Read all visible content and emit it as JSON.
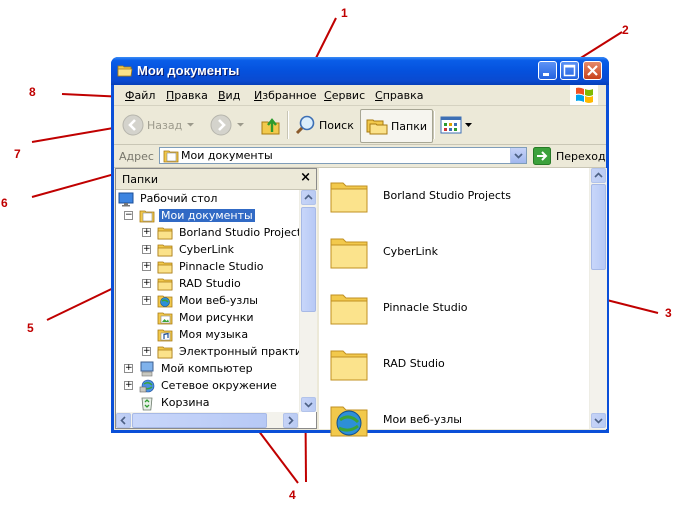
{
  "callouts": [
    "1",
    "2",
    "3",
    "4",
    "5",
    "6",
    "7",
    "8"
  ],
  "window": {
    "title": "Мои документы",
    "buttons": [
      "minimize",
      "maximize",
      "close"
    ]
  },
  "menu": {
    "items": [
      {
        "u": "Ф",
        "rest": "айл"
      },
      {
        "u": "П",
        "rest": "равка"
      },
      {
        "u": "В",
        "rest": "ид"
      },
      {
        "u": "И",
        "rest": "збранное"
      },
      {
        "u": "С",
        "rest": "ервис"
      },
      {
        "u": "С",
        "rest": "правка"
      }
    ]
  },
  "toolbar": {
    "back_label": "Назад",
    "search_label": "Поиск",
    "folders_label": "Папки"
  },
  "address": {
    "label": "Адрес",
    "value": "Мои документы",
    "go_label": "Переход"
  },
  "folder_pane": {
    "title": "Папки",
    "tree": [
      {
        "label": "Рабочий стол",
        "icon": "desktop-icon",
        "level": 0,
        "expander": ""
      },
      {
        "label": "Мои документы",
        "icon": "my-documents-icon",
        "level": 1,
        "expander": "−",
        "selected": true
      },
      {
        "label": "Borland Studio Projects",
        "icon": "folder-icon",
        "level": 2,
        "expander": "+"
      },
      {
        "label": "CyberLink",
        "icon": "folder-icon",
        "level": 2,
        "expander": "+"
      },
      {
        "label": "Pinnacle Studio",
        "icon": "folder-icon",
        "level": 2,
        "expander": "+"
      },
      {
        "label": "RAD Studio",
        "icon": "folder-icon",
        "level": 2,
        "expander": "+"
      },
      {
        "label": "Мои веб-узлы",
        "icon": "web-folder-icon",
        "level": 2,
        "expander": "+"
      },
      {
        "label": "Мои рисунки",
        "icon": "pictures-folder-icon",
        "level": 2,
        "expander": ""
      },
      {
        "label": "Моя музыка",
        "icon": "music-folder-icon",
        "level": 2,
        "expander": ""
      },
      {
        "label": "Электронный практикум",
        "icon": "folder-icon",
        "level": 2,
        "expander": "+"
      },
      {
        "label": "Мой компьютер",
        "icon": "computer-icon",
        "level": 1,
        "expander": "+"
      },
      {
        "label": "Сетевое окружение",
        "icon": "network-icon",
        "level": 1,
        "expander": "+"
      },
      {
        "label": "Корзина",
        "icon": "recycle-bin-icon",
        "level": 1,
        "expander": ""
      }
    ]
  },
  "content": {
    "items": [
      {
        "label": "Borland Studio Projects",
        "icon": "folder-icon"
      },
      {
        "label": "CyberLink",
        "icon": "folder-icon"
      },
      {
        "label": "Pinnacle Studio",
        "icon": "folder-icon"
      },
      {
        "label": "RAD Studio",
        "icon": "folder-icon"
      },
      {
        "label": "Мои веб-узлы",
        "icon": "web-folder-icon"
      }
    ]
  },
  "colors": {
    "titlebar": "#0551dd",
    "selection": "#316ac5",
    "callout": "#c00000",
    "chrome": "#ece9d8"
  }
}
